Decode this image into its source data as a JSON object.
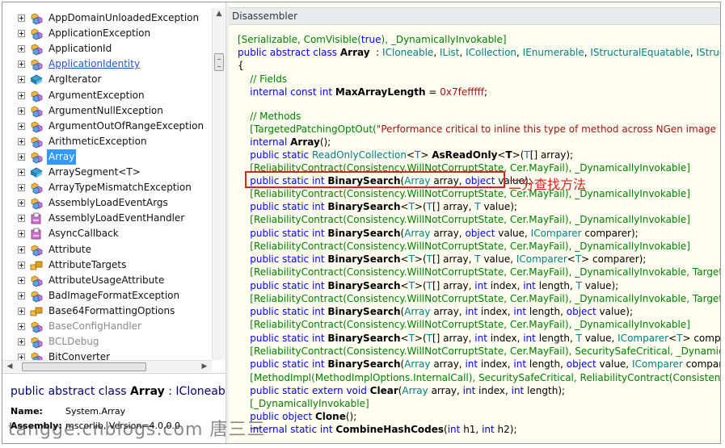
{
  "tree": {
    "items": [
      {
        "label": "AppDomainUnloadedException",
        "icon": "class-icon",
        "style": "normal"
      },
      {
        "label": "ApplicationException",
        "icon": "class-icon",
        "style": "normal"
      },
      {
        "label": "ApplicationId",
        "icon": "class-icon",
        "style": "normal"
      },
      {
        "label": "ApplicationIdentity",
        "icon": "class-icon",
        "style": "link"
      },
      {
        "label": "ArgIterator",
        "icon": "struct-icon",
        "style": "normal"
      },
      {
        "label": "ArgumentException",
        "icon": "class-icon",
        "style": "normal"
      },
      {
        "label": "ArgumentNullException",
        "icon": "class-icon",
        "style": "normal"
      },
      {
        "label": "ArgumentOutOfRangeException",
        "icon": "class-icon",
        "style": "normal"
      },
      {
        "label": "ArithmeticException",
        "icon": "class-icon",
        "style": "normal"
      },
      {
        "label": "Array",
        "icon": "class-icon",
        "style": "selected"
      },
      {
        "label": "ArraySegment<T>",
        "icon": "struct-icon",
        "style": "normal"
      },
      {
        "label": "ArrayTypeMismatchException",
        "icon": "class-icon",
        "style": "normal"
      },
      {
        "label": "AssemblyLoadEventArgs",
        "icon": "class-icon",
        "style": "normal"
      },
      {
        "label": "AssemblyLoadEventHandler",
        "icon": "delegate-icon",
        "style": "normal"
      },
      {
        "label": "AsyncCallback",
        "icon": "delegate-icon",
        "style": "normal"
      },
      {
        "label": "Attribute",
        "icon": "class-icon",
        "style": "normal"
      },
      {
        "label": "AttributeTargets",
        "icon": "enum-icon",
        "style": "normal"
      },
      {
        "label": "AttributeUsageAttribute",
        "icon": "class-icon",
        "style": "normal"
      },
      {
        "label": "BadImageFormatException",
        "icon": "class-icon",
        "style": "normal"
      },
      {
        "label": "Base64FormattingOptions",
        "icon": "enum-icon",
        "style": "normal"
      },
      {
        "label": "BaseConfigHandler",
        "icon": "class-icon",
        "style": "gray"
      },
      {
        "label": "BCLDebug",
        "icon": "class-icon",
        "style": "gray"
      },
      {
        "label": "BitConverter",
        "icon": "class-icon",
        "style": "normal"
      }
    ]
  },
  "detail": {
    "title_prefix": "public abstract class ",
    "title_name": "Array",
    "title_suffix": " : ICloneab",
    "rows": [
      {
        "key": "Name:",
        "value": "System.Array"
      },
      {
        "key": "Assembly:",
        "value": "mscorlib, Version=4.0.0.0"
      }
    ]
  },
  "disassembler": {
    "header": "Disassembler",
    "lines": [
      [
        [
          "at",
          "[Serializable, ComVisible("
        ],
        [
          "kw",
          "true"
        ],
        [
          "at",
          "), _DynamicallyInvokable]"
        ]
      ],
      [
        [
          "kw",
          "public abstract class "
        ],
        [
          "bd",
          "Array"
        ],
        [
          "",
          "  : "
        ],
        [
          "ty",
          "ICloneable"
        ],
        [
          "",
          ", "
        ],
        [
          "ty",
          "IList"
        ],
        [
          "",
          ", "
        ],
        [
          "ty",
          "ICollection"
        ],
        [
          "",
          ", "
        ],
        [
          "ty",
          "IEnumerable"
        ],
        [
          "",
          ", "
        ],
        [
          "ty",
          "IStructuralEquatable"
        ],
        [
          "",
          ", "
        ],
        [
          "ty",
          "IStructuralEq"
        ]
      ],
      [
        [
          "",
          "{"
        ]
      ],
      [
        [
          "cm",
          "    // Fields"
        ]
      ],
      [
        [
          "kw",
          "    internal const int "
        ],
        [
          "bd",
          "MaxArrayLength"
        ],
        [
          "",
          " = "
        ],
        [
          "lit",
          "0x7fefffff"
        ],
        [
          "",
          ";"
        ]
      ],
      [
        [
          "",
          ""
        ]
      ],
      [
        [
          "cm",
          "    // Methods"
        ]
      ],
      [
        [
          "at",
          "    [TargetedPatchingOptOut("
        ],
        [
          "lit",
          "\"Performance critical to inline this type of method across NGen image bounda"
        ]
      ],
      [
        [
          "kw",
          "    internal "
        ],
        [
          "bd",
          "Array"
        ],
        [
          "",
          "();"
        ]
      ],
      [
        [
          "kw",
          "    public static "
        ],
        [
          "ty",
          "ReadOnlyCollection"
        ],
        [
          "",
          "<"
        ],
        [
          "ty",
          "T"
        ],
        [
          "",
          "> "
        ],
        [
          "bd",
          "AsReadOnly"
        ],
        [
          "",
          "<"
        ],
        [
          "bd",
          "T"
        ],
        [
          "",
          ">("
        ],
        [
          "ty",
          "T"
        ],
        [
          "",
          "[] array);"
        ]
      ],
      [
        [
          "at",
          "    [ReliabilityContract(Consistency.WillNotCorruptState, Cer.MayFail), _DynamicallyInvokable]"
        ]
      ],
      [
        [
          "kw",
          "    public static int "
        ],
        [
          "bd",
          "BinarySearch"
        ],
        [
          "",
          "("
        ],
        [
          "ty",
          "Array"
        ],
        [
          "",
          " array, "
        ],
        [
          "kw",
          "object"
        ],
        [
          "",
          " value);"
        ]
      ],
      [
        [
          "at",
          "    [ReliabilityContract(Consistency.WillNotCorruptState, Cer.MayFail), _DynamicallyInvokable]"
        ]
      ],
      [
        [
          "kw",
          "    public static int "
        ],
        [
          "bd",
          "BinarySearch"
        ],
        [
          "",
          "<"
        ],
        [
          "ty",
          "T"
        ],
        [
          "",
          ">("
        ],
        [
          "ty",
          "T"
        ],
        [
          "",
          "[] array, "
        ],
        [
          "ty",
          "T"
        ],
        [
          "",
          " value);"
        ]
      ],
      [
        [
          "at",
          "    [ReliabilityContract(Consistency.WillNotCorruptState, Cer.MayFail), _DynamicallyInvokable]"
        ]
      ],
      [
        [
          "kw",
          "    public static int "
        ],
        [
          "bd",
          "BinarySearch"
        ],
        [
          "",
          "("
        ],
        [
          "ty",
          "Array"
        ],
        [
          "",
          " array, "
        ],
        [
          "kw",
          "object"
        ],
        [
          "",
          " value, "
        ],
        [
          "ty",
          "IComparer"
        ],
        [
          "",
          " comparer);"
        ]
      ],
      [
        [
          "at",
          "    [ReliabilityContract(Consistency.WillNotCorruptState, Cer.MayFail), _DynamicallyInvokable]"
        ]
      ],
      [
        [
          "kw",
          "    public static int "
        ],
        [
          "bd",
          "BinarySearch"
        ],
        [
          "",
          "<"
        ],
        [
          "ty",
          "T"
        ],
        [
          "",
          ">("
        ],
        [
          "ty",
          "T"
        ],
        [
          "",
          "[] array, "
        ],
        [
          "ty",
          "T"
        ],
        [
          "",
          " value, "
        ],
        [
          "ty",
          "IComparer"
        ],
        [
          "",
          "<"
        ],
        [
          "ty",
          "T"
        ],
        [
          "",
          "> comparer);"
        ]
      ],
      [
        [
          "at",
          "    [ReliabilityContract(Consistency.WillNotCorruptState, Cer.MayFail), _DynamicallyInvokable, TargetedPatc"
        ]
      ],
      [
        [
          "kw",
          "    public static int "
        ],
        [
          "bd",
          "BinarySearch"
        ],
        [
          "",
          "<"
        ],
        [
          "ty",
          "T"
        ],
        [
          "",
          ">("
        ],
        [
          "ty",
          "T"
        ],
        [
          "",
          "[] array, "
        ],
        [
          "kw",
          "int"
        ],
        [
          "",
          " index, "
        ],
        [
          "kw",
          "int"
        ],
        [
          "",
          " length, "
        ],
        [
          "ty",
          "T"
        ],
        [
          "",
          " value);"
        ]
      ],
      [
        [
          "at",
          "    [ReliabilityContract(Consistency.WillNotCorruptState, Cer.MayFail), _DynamicallyInvokable, TargetedPatc"
        ]
      ],
      [
        [
          "kw",
          "    public static int "
        ],
        [
          "bd",
          "BinarySearch"
        ],
        [
          "",
          "("
        ],
        [
          "ty",
          "Array"
        ],
        [
          "",
          " array, "
        ],
        [
          "kw",
          "int"
        ],
        [
          "",
          " index, "
        ],
        [
          "kw",
          "int"
        ],
        [
          "",
          " length, "
        ],
        [
          "kw",
          "object"
        ],
        [
          "",
          " value);"
        ]
      ],
      [
        [
          "at",
          "    [ReliabilityContract(Consistency.WillNotCorruptState, Cer.MayFail), _DynamicallyInvokable]"
        ]
      ],
      [
        [
          "kw",
          "    public static int "
        ],
        [
          "bd",
          "BinarySearch"
        ],
        [
          "",
          "<"
        ],
        [
          "ty",
          "T"
        ],
        [
          "",
          ">("
        ],
        [
          "ty",
          "T"
        ],
        [
          "",
          "[] array, "
        ],
        [
          "kw",
          "int"
        ],
        [
          "",
          " index, "
        ],
        [
          "kw",
          "int"
        ],
        [
          "",
          " length, "
        ],
        [
          "ty",
          "T"
        ],
        [
          "",
          " value, "
        ],
        [
          "ty",
          "IComparer"
        ],
        [
          "",
          "<"
        ],
        [
          "ty",
          "T"
        ],
        [
          "",
          "> comparer);"
        ]
      ],
      [
        [
          "at",
          "    [ReliabilityContract(Consistency.WillNotCorruptState, Cer.MayFail), SecuritySafeCritical, _DynamicallyInvo"
        ]
      ],
      [
        [
          "kw",
          "    public static int "
        ],
        [
          "bd",
          "BinarySearch"
        ],
        [
          "",
          "("
        ],
        [
          "ty",
          "Array"
        ],
        [
          "",
          " array, "
        ],
        [
          "kw",
          "int"
        ],
        [
          "",
          " index, "
        ],
        [
          "kw",
          "int"
        ],
        [
          "",
          " length, "
        ],
        [
          "kw",
          "object"
        ],
        [
          "",
          " value, "
        ],
        [
          "ty",
          "IComparer"
        ],
        [
          "",
          " comparer);"
        ]
      ],
      [
        [
          "at",
          "    [MethodImpl(MethodImplOptions.InternalCall), SecuritySafeCritical, ReliabilityContract(Consistency.WillNo"
        ]
      ],
      [
        [
          "kw",
          "    public static extern void "
        ],
        [
          "bd",
          "Clear"
        ],
        [
          "",
          "("
        ],
        [
          "ty",
          "Array"
        ],
        [
          "",
          " array, "
        ],
        [
          "kw",
          "int"
        ],
        [
          "",
          " index, "
        ],
        [
          "kw",
          "int"
        ],
        [
          "",
          " length);"
        ]
      ],
      [
        [
          "at",
          "    [_DynamicallyInvokable]"
        ]
      ],
      [
        [
          "kw",
          "    public object "
        ],
        [
          "bd",
          "Clone"
        ],
        [
          "",
          "();"
        ]
      ],
      [
        [
          "kw",
          "    internal static int "
        ],
        [
          "bd",
          "CombineHashCodes"
        ],
        [
          "",
          "("
        ],
        [
          "kw",
          "int"
        ],
        [
          "",
          " h1, "
        ],
        [
          "kw",
          "int"
        ],
        [
          "",
          " h2);"
        ]
      ]
    ],
    "annotation": "二分查找方法"
  },
  "watermark": "tangge.cnblogs.com  唐三三"
}
